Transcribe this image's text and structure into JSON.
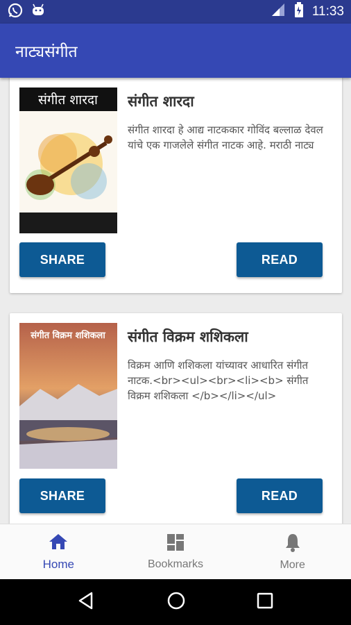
{
  "status_bar": {
    "time": "11:33",
    "icons": [
      "whatsapp-icon",
      "android-icon",
      "signal-icon",
      "battery-icon"
    ]
  },
  "app_bar": {
    "title": "नाट्यसंगीत"
  },
  "cards": [
    {
      "cover_caption": "संगीत शारदा",
      "title": "संगीत शारदा",
      "description": "संगीत शारदा हे आद्य नाटककार गोविंद बल्लाळ देवल यांचे एक गाजलेले संगीत नाटक आहे. मराठी नाट्य",
      "share_label": "SHARE",
      "read_label": "READ"
    },
    {
      "cover_caption": "संगीत विक्रम शशिकला",
      "title": "संगीत विक्रम शशिकला",
      "description": "विक्रम आणि शशिकला यांच्यावर आधारित संगीत नाटक.<br><ul><br><li><b> संगीत विक्रम शशिकला </b></li></ul>",
      "share_label": "SHARE",
      "read_label": "READ"
    }
  ],
  "bottom_nav": {
    "items": [
      {
        "label": "Home",
        "icon": "home-icon",
        "active": true
      },
      {
        "label": "Bookmarks",
        "icon": "bookmarks-icon",
        "active": false
      },
      {
        "label": "More",
        "icon": "bell-icon",
        "active": false
      }
    ]
  },
  "colors": {
    "status_bar": "#2b3a8f",
    "app_bar": "#3548b4",
    "button": "#0d5a94",
    "active_nav": "#3548b4"
  }
}
